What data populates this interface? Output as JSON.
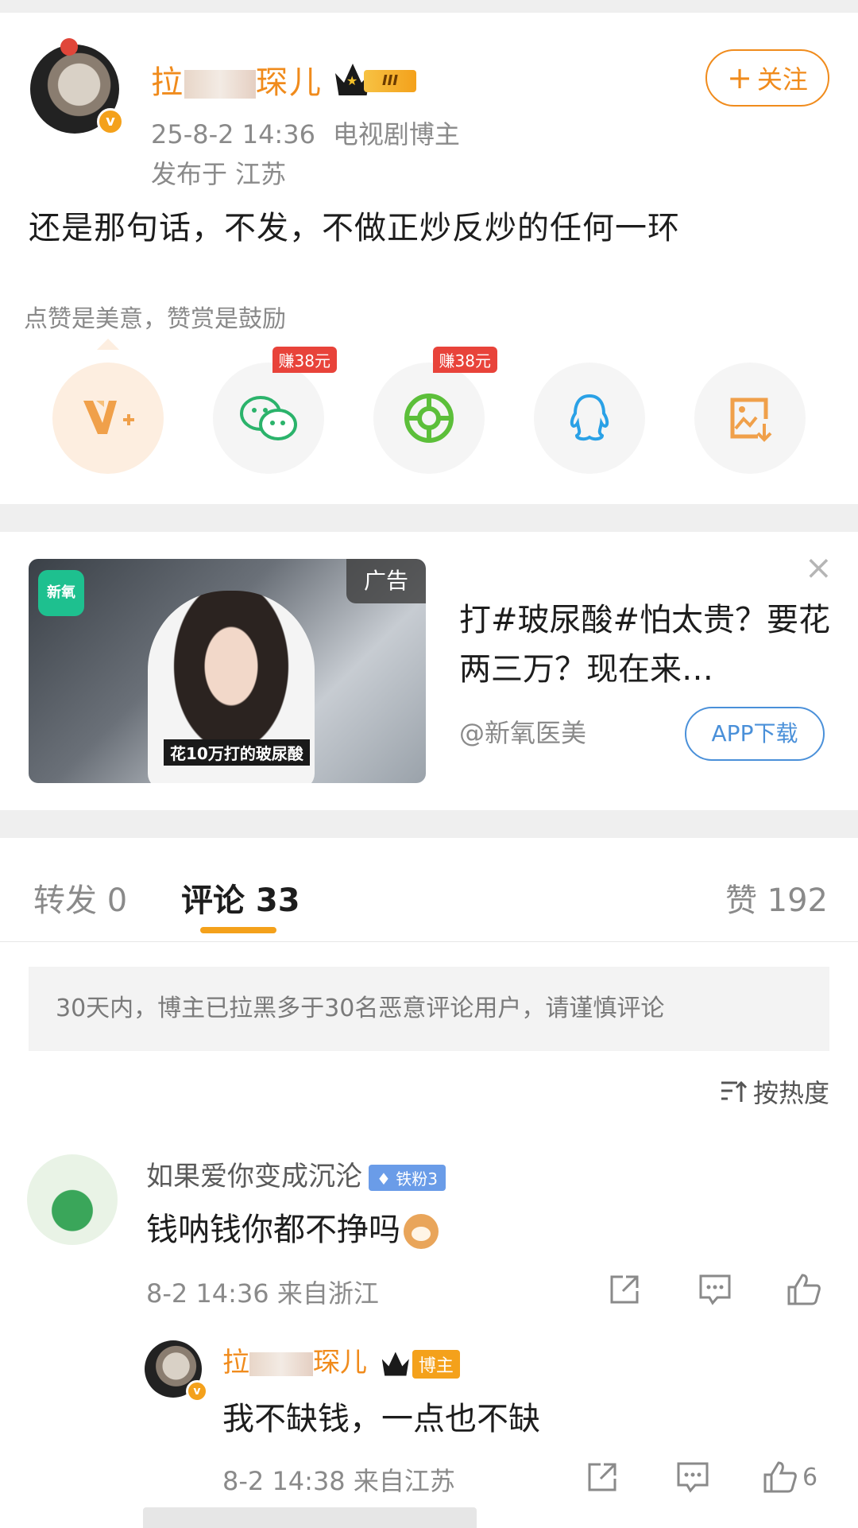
{
  "post": {
    "username_start": "拉",
    "username_end": "琛儿",
    "level": "III",
    "time": "25-8-2 14:36",
    "role": "电视剧博主",
    "location": "发布于 江苏",
    "follow_label": "关注",
    "text": "还是那句话，不发，不做正炒反炒的任何一环",
    "like_tip": "点赞是美意，赞赏是鼓励",
    "share": [
      {
        "icon": "v-plus-icon",
        "badge": ""
      },
      {
        "icon": "wechat-icon",
        "badge": "赚38元"
      },
      {
        "icon": "moments-icon",
        "badge": "赚38元"
      },
      {
        "icon": "qq-icon",
        "badge": ""
      },
      {
        "icon": "save-image-icon",
        "badge": ""
      }
    ]
  },
  "ad": {
    "tag": "广告",
    "logo": "新氧",
    "caption": "花10万打的玻尿酸",
    "title": "打#玻尿酸#怕太贵？要花两三万？现在来…",
    "source": "@新氧医美",
    "button": "APP下载",
    "close": "×"
  },
  "tabs": {
    "repost": "转发 0",
    "comments": "评论 33",
    "likes": "赞 192"
  },
  "notice": "30天内，博主已拉黑多于30名恶意评论用户，请谨慎评论",
  "sort_label": "按热度",
  "comments": [
    {
      "name": "如果爱你变成沉沦",
      "badge": "铁粉3",
      "text": "钱呐钱你都不挣吗",
      "meta": "8-2 14:36 来自浙江"
    }
  ],
  "reply": {
    "name_start": "拉",
    "name_end": "琛儿",
    "badge": "博主",
    "text": "我不缺钱，一点也不缺",
    "meta": "8-2 14:38 来自江苏",
    "like_count": "6"
  },
  "colors": {
    "accent": "#f08b1c",
    "link": "#4a90d9",
    "red": "#e8433a"
  }
}
